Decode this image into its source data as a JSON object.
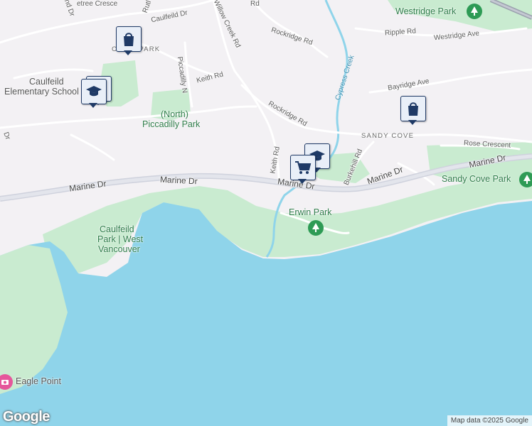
{
  "map": {
    "roads": {
      "marine_dr_1": "Marine Dr",
      "marine_dr_2": "Marine Dr",
      "marine_dr_3": "Marine Dr",
      "marine_dr_4": "Marine Dr",
      "marine_dr_5": "Marine Dr",
      "willow_creek_rd": "Willow Creek Rd",
      "rockridge_rd_1": "Rockridge Rd",
      "rockridge_rd_2": "Rockridge Rd",
      "keith_rd_1": "Keith Rd",
      "keith_rd_2": "Keith Rd",
      "caulfeild_dr": "Caulfeild Dr",
      "piccadilly_n": "Piccadilly N",
      "ripple_rd": "Ripple Rd",
      "westridge_ave": "Westridge Ave",
      "bayridge_ave": "Bayridge Ave",
      "burkehill_rd": "Burkehill Rd",
      "rose_crescent": "Rose Crescent",
      "partial_dr_left": "Dr",
      "partial_island_dr": "land Dr",
      "partial_crescent": "etree Cresce",
      "partial_rutl": "Rutl",
      "partial_rd_top": "Rd"
    },
    "parks": {
      "westridge": "Westridge Park",
      "north_piccadilly_1": "(North)",
      "north_piccadilly_2": "Piccadilly Park",
      "sandy_cove_park": "Sandy Cove Park",
      "erwin": "Erwin Park",
      "caulfeild_1": "Caulfeild",
      "caulfeild_2": "Park | West",
      "caulfeild_3": "Vancouver"
    },
    "areas": {
      "sandy_cove": "SANDY COVE",
      "cypress_park": "C  ESS PARK"
    },
    "water": {
      "cypress_creek": "Cypress Creek"
    },
    "pois": {
      "caulfeild_school_1": "Caulfeild",
      "caulfeild_school_2": "Elementary School",
      "eagle_point": "Eagle Point"
    },
    "markers": {
      "shopping_bag_1": "shopping-bag-icon",
      "shopping_bag_2": "shopping-bag-icon",
      "school_1": "graduation-cap-icon",
      "school_2": "graduation-cap-icon",
      "cart": "shopping-cart-icon"
    },
    "branding": {
      "logo": "Google",
      "attribution": "Map data ©2025 Google"
    },
    "colors": {
      "water": "#8fd4ea",
      "land": "#f3f1f4",
      "park": "#c9ebd0",
      "road": "#d8dae4",
      "marker_border": "#1f3a66"
    }
  }
}
